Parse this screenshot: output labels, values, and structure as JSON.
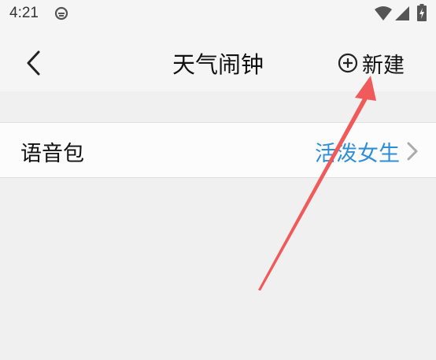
{
  "status_bar": {
    "time": "4:21",
    "icons": [
      "app-notification-icon",
      "wifi-icon",
      "signal-icon",
      "battery-charging-icon"
    ]
  },
  "header": {
    "title": "天气闹钟",
    "back_icon": "chevron-left-icon",
    "new_label": "新建",
    "new_icon": "circle-plus-icon"
  },
  "settings": {
    "voice_pack": {
      "label": "语音包",
      "value": "活泼女生"
    }
  },
  "colors": {
    "accent": "#2e8fd8",
    "annotation": "#f05a5a",
    "background": "#f0f0f0"
  }
}
